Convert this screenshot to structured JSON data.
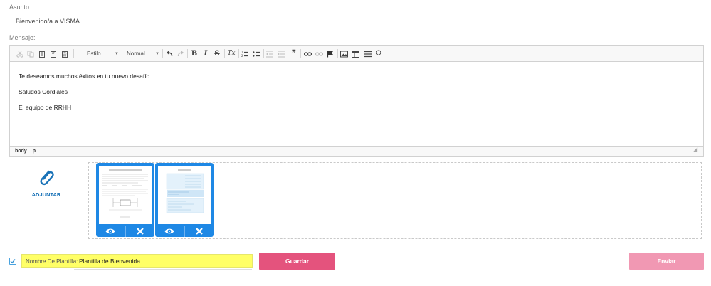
{
  "form": {
    "subject_label": "Asunto:",
    "subject_value": "Bienvenido/a a VISMA",
    "message_label": "Mensaje:"
  },
  "editor": {
    "toolbar": {
      "style_combo": "Estilo",
      "format_combo": "Normal",
      "icons": [
        "cut-icon",
        "copy-icon",
        "paste-icon",
        "paste-text-icon",
        "paste-word-icon",
        "undo-icon",
        "redo-icon",
        "bold-icon",
        "italic-icon",
        "strikethrough-icon",
        "remove-format-icon",
        "numbered-list-icon",
        "bulleted-list-icon",
        "outdent-icon",
        "indent-icon",
        "blockquote-icon",
        "link-icon",
        "unlink-icon",
        "anchor-icon",
        "image-icon",
        "table-icon",
        "horizontal-rule-icon",
        "special-char-icon"
      ],
      "glyphs": {
        "bold": "B",
        "italic": "I",
        "strike": "S",
        "clear": "Tx",
        "quote": "❞",
        "omega": "Ω"
      }
    },
    "content": [
      "Te deseamos muchos éxitos en tu nuevo desafío.",
      "Saludos Cordiales",
      "El equipo de RRHH"
    ],
    "path": [
      "body",
      "p"
    ]
  },
  "attachments": {
    "label": "ADJUNTAR",
    "files": [
      {
        "name": "document-thumbnail-1"
      },
      {
        "name": "document-thumbnail-2"
      }
    ]
  },
  "template": {
    "checked": true,
    "label": "Nombre De Plantilla:",
    "value": "Plantilla de Bienvenida",
    "highlight_color": "#ffff66"
  },
  "actions": {
    "save_label": "Guardar",
    "send_label": "Enviar"
  },
  "colors": {
    "save": "#e4537d",
    "send": "#f198b3",
    "thumb_frame": "#1e88e5",
    "attach_accent": "#1a73b8"
  }
}
